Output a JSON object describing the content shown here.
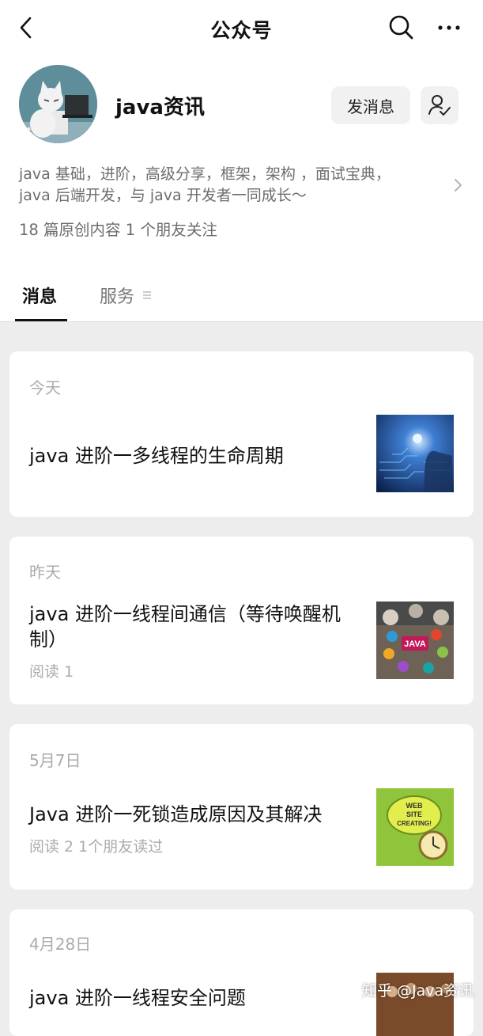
{
  "topbar": {
    "title": "公众号",
    "back_icon": "chevron-left-icon",
    "search_icon": "search-icon",
    "more_icon": "more-icon"
  },
  "account": {
    "name": "java资讯",
    "message_button": "发消息",
    "follow_icon": "user-check-icon",
    "description_line1": "java 基础，进阶，高级分享，框架，架构 ，面试宝典，",
    "description_line2": "java 后端开发，与 java 开发者一同成长～",
    "stats": "18 篇原创内容  1 个朋友关注"
  },
  "tabs": [
    {
      "label": "消息",
      "active": true
    },
    {
      "label": "服务",
      "active": false
    }
  ],
  "articles": [
    {
      "date": "今天",
      "title": "java 进阶一多线程的生命周期",
      "meta": "",
      "thumb": "tech-hand-image"
    },
    {
      "date": "昨天",
      "title": "java 进阶一线程间通信（等待唤醒机制）",
      "meta": "阅读 1",
      "thumb": "java-icons-image"
    },
    {
      "date": "5月7日",
      "title": "Java 进阶一死锁造成原因及其解决",
      "meta": "阅读 2   1个朋友读过",
      "thumb": "web-site-creating-image"
    },
    {
      "date": "4月28日",
      "title": "java 进阶一线程安全问题",
      "meta": "",
      "thumb": "photo-image"
    }
  ],
  "thumb_texts": {
    "java_badge": "JAVA",
    "web_line1": "WEB",
    "web_line2": "SITE",
    "web_line3": "CREATING!"
  },
  "watermark": "知乎 @Java资讯"
}
